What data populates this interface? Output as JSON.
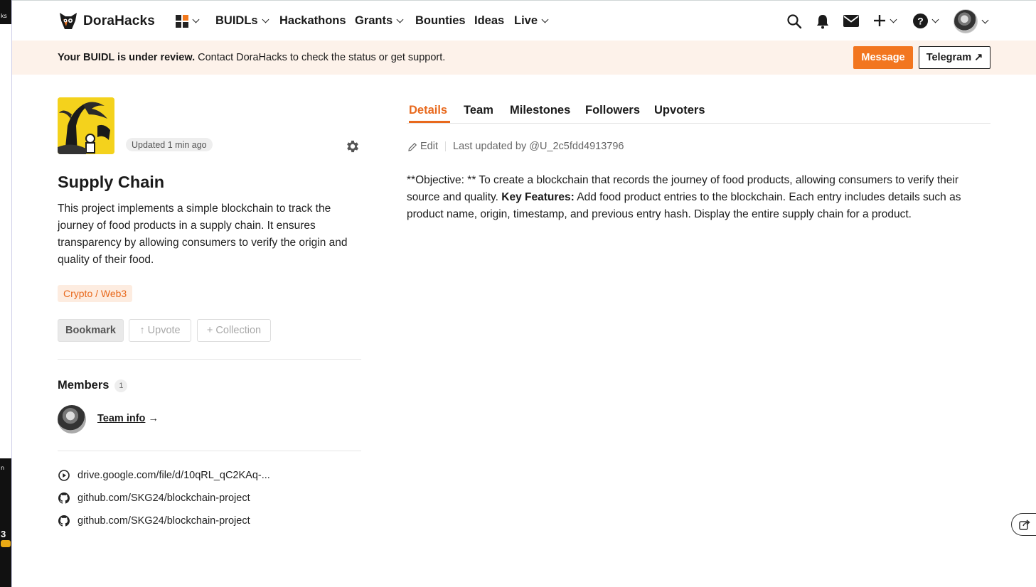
{
  "left_strip": {
    "top_text": "ks",
    "mid_text": "n",
    "number": "3"
  },
  "nav": {
    "brand": "DoraHacks",
    "items": [
      {
        "label": "BUIDLs",
        "dropdown": true
      },
      {
        "label": "Hackathons",
        "dropdown": false
      },
      {
        "label": "Grants",
        "dropdown": true
      },
      {
        "label": "Bounties",
        "dropdown": false
      },
      {
        "label": "Ideas",
        "dropdown": false
      },
      {
        "label": "Live",
        "dropdown": true
      }
    ],
    "icons": [
      "apps-grid-icon",
      "search-icon",
      "bell-icon",
      "mail-icon",
      "plus-icon",
      "help-icon",
      "avatar"
    ]
  },
  "banner": {
    "bold": "Your BUIDL is under review.",
    "text": " Contact DoraHacks to check the status or get support.",
    "message_label": "Message",
    "telegram_label": "Telegram ↗"
  },
  "project": {
    "updated": "Updated 1 min ago",
    "title": "Supply Chain",
    "description": "This project implements a simple blockchain to track the journey of food products in a supply chain. It ensures transparency by allowing consumers to verify the origin and quality of their food.",
    "tag": "Crypto / Web3",
    "bookmark_label": "Bookmark",
    "upvote_label": "↑ Upvote",
    "collection_label": "+ Collection",
    "members_label": "Members",
    "members_count": "1",
    "team_info_label": "Team info",
    "team_info_arrow": "→",
    "links": [
      {
        "icon": "play-circle-icon",
        "text": "drive.google.com/file/d/10qRL_qC2KAq-..."
      },
      {
        "icon": "github-icon",
        "text": "github.com/SKG24/blockchain-project"
      },
      {
        "icon": "github-icon",
        "text": "github.com/SKG24/blockchain-project"
      }
    ]
  },
  "tabs": [
    "Details",
    "Team",
    "Milestones",
    "Followers",
    "Upvoters"
  ],
  "details": {
    "edit_label": "Edit",
    "last_updated": "Last updated by @U_2c5fdd4913796",
    "part1": "**Objective: ** To create a blockchain that records the journey of food products, allowing consumers to verify their source and quality. ",
    "bold": "Key Features:",
    "part2": " Add food product entries to the blockchain. Each entry includes details such as product name, origin, timestamp, and previous entry hash. Display the entire supply chain for a product."
  },
  "colors": {
    "accent": "#f2761f",
    "banner_bg": "#fdf2ea",
    "tag_bg": "#fdece0"
  }
}
